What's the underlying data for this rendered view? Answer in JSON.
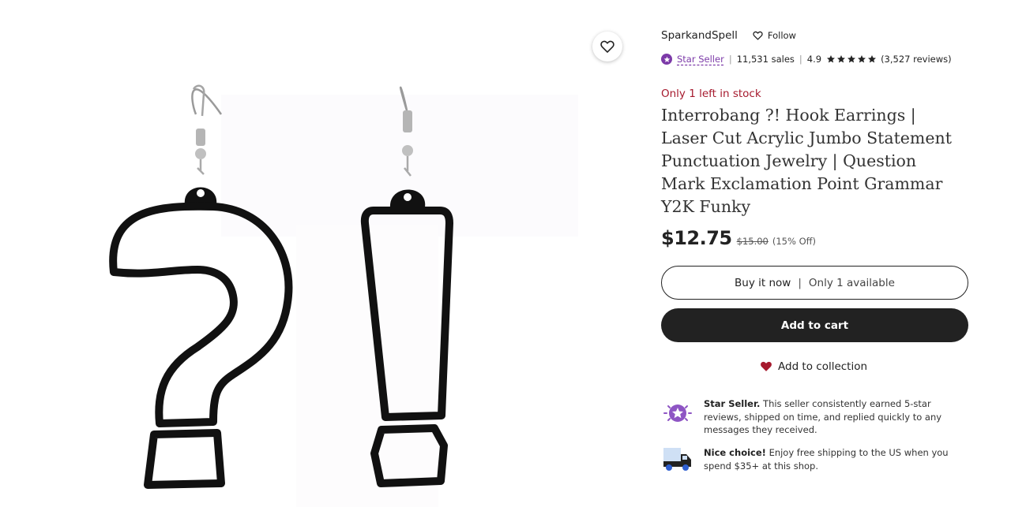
{
  "shop": {
    "name": "SparkandSpell",
    "follow_label": "Follow"
  },
  "rating": {
    "star_seller_label": "Star Seller",
    "sales": "11,531 sales",
    "score": "4.9",
    "stars": 5,
    "reviews": "(3,527 reviews)"
  },
  "listing": {
    "stock": "Only 1 left in stock",
    "title": "Interrobang ?! Hook Earrings | Laser Cut Acrylic Jumbo Statement Punctuation Jewelry | Question Mark Exclamation Point Grammar Y2K Funky",
    "price": "$12.75",
    "original_price": "$15.00",
    "discount": "(15% Off)"
  },
  "actions": {
    "buy_now_label": "Buy it now",
    "divider": "|",
    "availability": "Only 1 available",
    "add_to_cart_label": "Add to cart",
    "add_to_collection_label": "Add to collection"
  },
  "highlights": {
    "star_seller_title": "Star Seller.",
    "star_seller_text": "This seller consistently earned 5-star reviews, shipped on time, and replied quickly to any messages they received.",
    "shipping_title": "Nice choice!",
    "shipping_text": "Enjoy free shipping to the US when you spend $35+ at this shop."
  },
  "colors": {
    "accent_purple": "#7c3aa8",
    "stock_red": "#a61a2e",
    "button_dark": "#222222",
    "heart_red": "#a61a2e"
  },
  "icons": {
    "favorite": "heart-outline-icon",
    "follow": "heart-outline-icon",
    "star_badge": "star-badge-icon",
    "rating_star": "star-icon",
    "collection": "heart-filled-icon",
    "star_seller": "star-seller-badge-icon",
    "shipping": "truck-icon"
  }
}
